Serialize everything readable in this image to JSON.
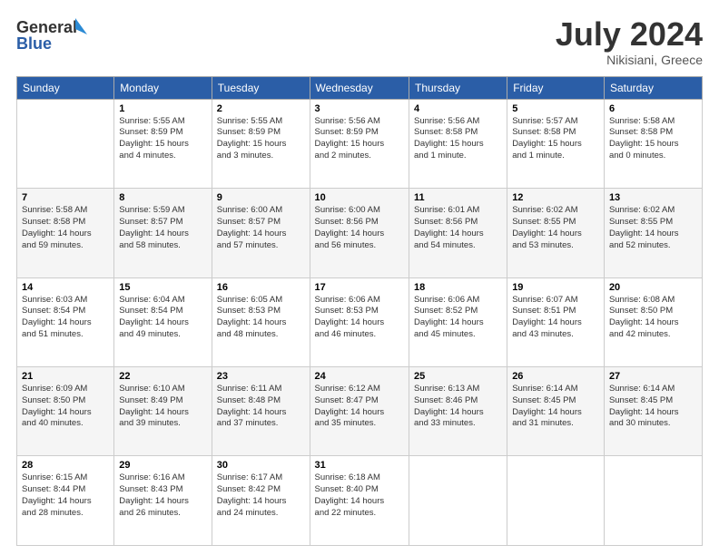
{
  "header": {
    "logo_general": "General",
    "logo_blue": "Blue",
    "month_year": "July 2024",
    "location": "Nikisiani, Greece"
  },
  "weekdays": [
    "Sunday",
    "Monday",
    "Tuesday",
    "Wednesday",
    "Thursday",
    "Friday",
    "Saturday"
  ],
  "weeks": [
    [
      {
        "day": "",
        "info": ""
      },
      {
        "day": "1",
        "info": "Sunrise: 5:55 AM\nSunset: 8:59 PM\nDaylight: 15 hours\nand 4 minutes."
      },
      {
        "day": "2",
        "info": "Sunrise: 5:55 AM\nSunset: 8:59 PM\nDaylight: 15 hours\nand 3 minutes."
      },
      {
        "day": "3",
        "info": "Sunrise: 5:56 AM\nSunset: 8:59 PM\nDaylight: 15 hours\nand 2 minutes."
      },
      {
        "day": "4",
        "info": "Sunrise: 5:56 AM\nSunset: 8:58 PM\nDaylight: 15 hours\nand 1 minute."
      },
      {
        "day": "5",
        "info": "Sunrise: 5:57 AM\nSunset: 8:58 PM\nDaylight: 15 hours\nand 1 minute."
      },
      {
        "day": "6",
        "info": "Sunrise: 5:58 AM\nSunset: 8:58 PM\nDaylight: 15 hours\nand 0 minutes."
      }
    ],
    [
      {
        "day": "7",
        "info": "Sunrise: 5:58 AM\nSunset: 8:58 PM\nDaylight: 14 hours\nand 59 minutes."
      },
      {
        "day": "8",
        "info": "Sunrise: 5:59 AM\nSunset: 8:57 PM\nDaylight: 14 hours\nand 58 minutes."
      },
      {
        "day": "9",
        "info": "Sunrise: 6:00 AM\nSunset: 8:57 PM\nDaylight: 14 hours\nand 57 minutes."
      },
      {
        "day": "10",
        "info": "Sunrise: 6:00 AM\nSunset: 8:56 PM\nDaylight: 14 hours\nand 56 minutes."
      },
      {
        "day": "11",
        "info": "Sunrise: 6:01 AM\nSunset: 8:56 PM\nDaylight: 14 hours\nand 54 minutes."
      },
      {
        "day": "12",
        "info": "Sunrise: 6:02 AM\nSunset: 8:55 PM\nDaylight: 14 hours\nand 53 minutes."
      },
      {
        "day": "13",
        "info": "Sunrise: 6:02 AM\nSunset: 8:55 PM\nDaylight: 14 hours\nand 52 minutes."
      }
    ],
    [
      {
        "day": "14",
        "info": "Sunrise: 6:03 AM\nSunset: 8:54 PM\nDaylight: 14 hours\nand 51 minutes."
      },
      {
        "day": "15",
        "info": "Sunrise: 6:04 AM\nSunset: 8:54 PM\nDaylight: 14 hours\nand 49 minutes."
      },
      {
        "day": "16",
        "info": "Sunrise: 6:05 AM\nSunset: 8:53 PM\nDaylight: 14 hours\nand 48 minutes."
      },
      {
        "day": "17",
        "info": "Sunrise: 6:06 AM\nSunset: 8:53 PM\nDaylight: 14 hours\nand 46 minutes."
      },
      {
        "day": "18",
        "info": "Sunrise: 6:06 AM\nSunset: 8:52 PM\nDaylight: 14 hours\nand 45 minutes."
      },
      {
        "day": "19",
        "info": "Sunrise: 6:07 AM\nSunset: 8:51 PM\nDaylight: 14 hours\nand 43 minutes."
      },
      {
        "day": "20",
        "info": "Sunrise: 6:08 AM\nSunset: 8:50 PM\nDaylight: 14 hours\nand 42 minutes."
      }
    ],
    [
      {
        "day": "21",
        "info": "Sunrise: 6:09 AM\nSunset: 8:50 PM\nDaylight: 14 hours\nand 40 minutes."
      },
      {
        "day": "22",
        "info": "Sunrise: 6:10 AM\nSunset: 8:49 PM\nDaylight: 14 hours\nand 39 minutes."
      },
      {
        "day": "23",
        "info": "Sunrise: 6:11 AM\nSunset: 8:48 PM\nDaylight: 14 hours\nand 37 minutes."
      },
      {
        "day": "24",
        "info": "Sunrise: 6:12 AM\nSunset: 8:47 PM\nDaylight: 14 hours\nand 35 minutes."
      },
      {
        "day": "25",
        "info": "Sunrise: 6:13 AM\nSunset: 8:46 PM\nDaylight: 14 hours\nand 33 minutes."
      },
      {
        "day": "26",
        "info": "Sunrise: 6:14 AM\nSunset: 8:45 PM\nDaylight: 14 hours\nand 31 minutes."
      },
      {
        "day": "27",
        "info": "Sunrise: 6:14 AM\nSunset: 8:45 PM\nDaylight: 14 hours\nand 30 minutes."
      }
    ],
    [
      {
        "day": "28",
        "info": "Sunrise: 6:15 AM\nSunset: 8:44 PM\nDaylight: 14 hours\nand 28 minutes."
      },
      {
        "day": "29",
        "info": "Sunrise: 6:16 AM\nSunset: 8:43 PM\nDaylight: 14 hours\nand 26 minutes."
      },
      {
        "day": "30",
        "info": "Sunrise: 6:17 AM\nSunset: 8:42 PM\nDaylight: 14 hours\nand 24 minutes."
      },
      {
        "day": "31",
        "info": "Sunrise: 6:18 AM\nSunset: 8:40 PM\nDaylight: 14 hours\nand 22 minutes."
      },
      {
        "day": "",
        "info": ""
      },
      {
        "day": "",
        "info": ""
      },
      {
        "day": "",
        "info": ""
      }
    ]
  ]
}
